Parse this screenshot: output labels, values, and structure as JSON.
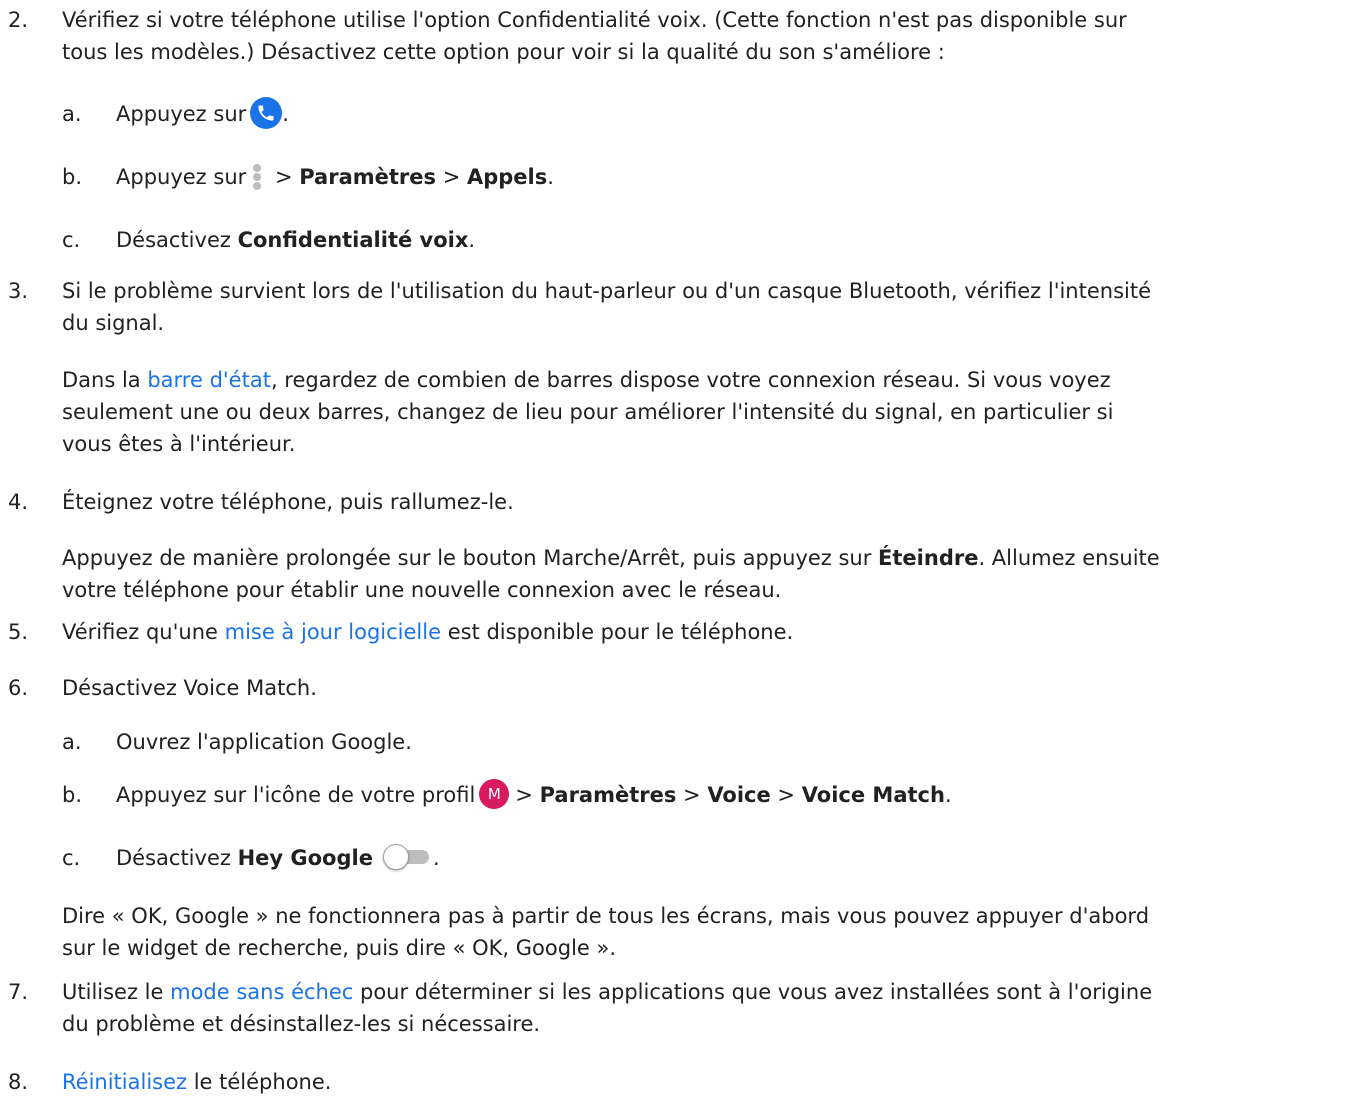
{
  "item2": {
    "number": "2.",
    "line1": "Vérifiez si votre téléphone utilise l'option Confidentialité voix. (Cette fonction n'est pas disponible sur",
    "line2": "tous les modèles.) Désactivez cette option pour voir si la qualité du son s'améliore :",
    "a": {
      "letter": "a.",
      "pre": "Appuyez sur",
      "post": ".",
      "icon": "phone-icon"
    },
    "b": {
      "letter": "b.",
      "pre": "Appuyez sur",
      "sep1": " > ",
      "bold1": "Paramètres",
      "sep2": " > ",
      "bold2": "Appels",
      "post": ".",
      "icon": "more-vert-icon"
    },
    "c": {
      "letter": "c.",
      "pre": "Désactivez ",
      "bold": "Confidentialité voix",
      "post": "."
    }
  },
  "item3": {
    "number": "3.",
    "line1": "Si le problème survient lors de l'utilisation du haut-parleur ou d'un casque Bluetooth, vérifiez l'intensité",
    "line2": "du signal.",
    "para": {
      "pre": "Dans la ",
      "link": "barre d'état",
      "l1rest": ", regardez de combien de barres dispose votre connexion réseau. Si vous voyez",
      "l2": "seulement une ou deux barres, changez de lieu pour améliorer l'intensité du signal, en particulier si",
      "l3": "vous êtes à l'intérieur."
    }
  },
  "item4": {
    "number": "4.",
    "line1": "Éteignez votre téléphone, puis rallumez-le.",
    "para": {
      "pre": "Appuyez de manière prolongée sur le bouton Marche/Arrêt, puis appuyez sur ",
      "bold": "Éteindre",
      "post": ". Allumez ensuite",
      "l2": "votre téléphone pour établir une nouvelle connexion avec le réseau."
    }
  },
  "item5": {
    "number": "5.",
    "pre": "Vérifiez qu'une ",
    "link": "mise à jour logicielle",
    "post": " est disponible pour le téléphone."
  },
  "item6": {
    "number": "6.",
    "line1": "Désactivez Voice Match.",
    "a": {
      "letter": "a.",
      "text": "Ouvrez l'application Google."
    },
    "b": {
      "letter": "b.",
      "pre": "Appuyez sur l'icône de votre profil",
      "avatar_letter": "M",
      "sep1": "> ",
      "bold1": "Paramètres",
      "sep2": " > ",
      "bold2": "Voice",
      "sep3": " > ",
      "bold3": "Voice Match",
      "post": "."
    },
    "c": {
      "letter": "c.",
      "pre": "Désactivez ",
      "bold": "Hey Google",
      "post": ".",
      "toggle_state": "off"
    },
    "para": {
      "l1": "Dire « OK, Google » ne fonctionnera pas à partir de tous les écrans, mais vous pouvez appuyer d'abord",
      "l2": "sur le widget de recherche, puis dire « OK, Google »."
    }
  },
  "item7": {
    "number": "7.",
    "pre": "Utilisez le ",
    "link": "mode sans échec",
    "l1rest": " pour déterminer si les applications que vous avez installées sont à l'origine",
    "l2": "du problème et désinstallez-les si nécessaire."
  },
  "item8": {
    "number": "8.",
    "link": "Réinitialisez",
    "post": " le téléphone."
  },
  "colors": {
    "text": "#212121",
    "link": "#1a73e8",
    "phone_icon_bg": "#1a73e8",
    "avatar_bg": "#d81b60",
    "toggle_track": "#bdbdbd"
  }
}
